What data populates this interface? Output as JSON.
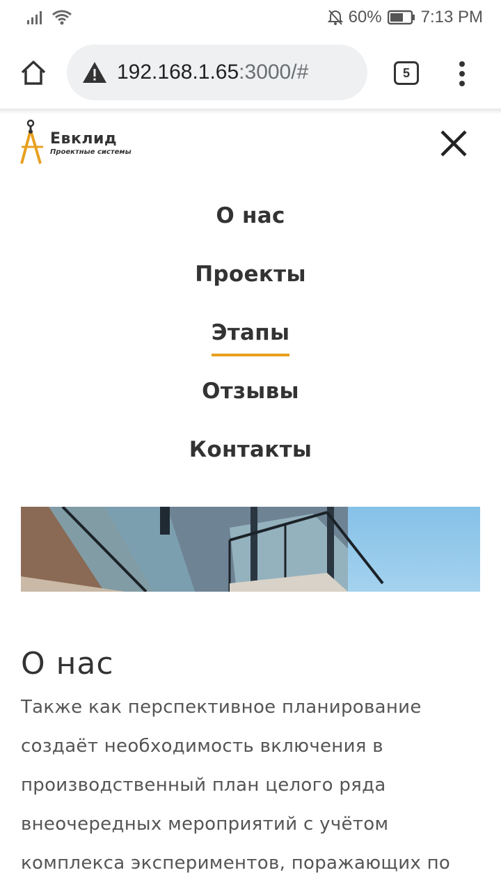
{
  "status_bar": {
    "battery_percent": "60%",
    "time": "7:13 PM",
    "icons": [
      "signal-icon",
      "wifi-icon",
      "mute-bell-icon",
      "battery-icon"
    ]
  },
  "browser": {
    "url_host": "192.168.1.65",
    "url_port_path": ":3000/#",
    "tab_count": "5",
    "icons": [
      "home-icon",
      "warning-icon",
      "tabs-icon",
      "more-menu-icon"
    ]
  },
  "site": {
    "logo_name": "Евклид",
    "logo_subtitle": "Проектные системы",
    "accent_color": "#e8a020"
  },
  "nav": {
    "items": [
      {
        "label": "О нас"
      },
      {
        "label": "Проекты"
      },
      {
        "label": "Этапы",
        "active": true
      },
      {
        "label": "Отзывы"
      },
      {
        "label": "Контакты"
      }
    ]
  },
  "about": {
    "title": "О нас",
    "lines": [
      "Также как перспективное планирование",
      "создаёт необходимость включения в",
      "производственный план целого ряда",
      "внеочередных мероприятий с учётом",
      "комплекса экспериментов, поражающих по"
    ]
  }
}
